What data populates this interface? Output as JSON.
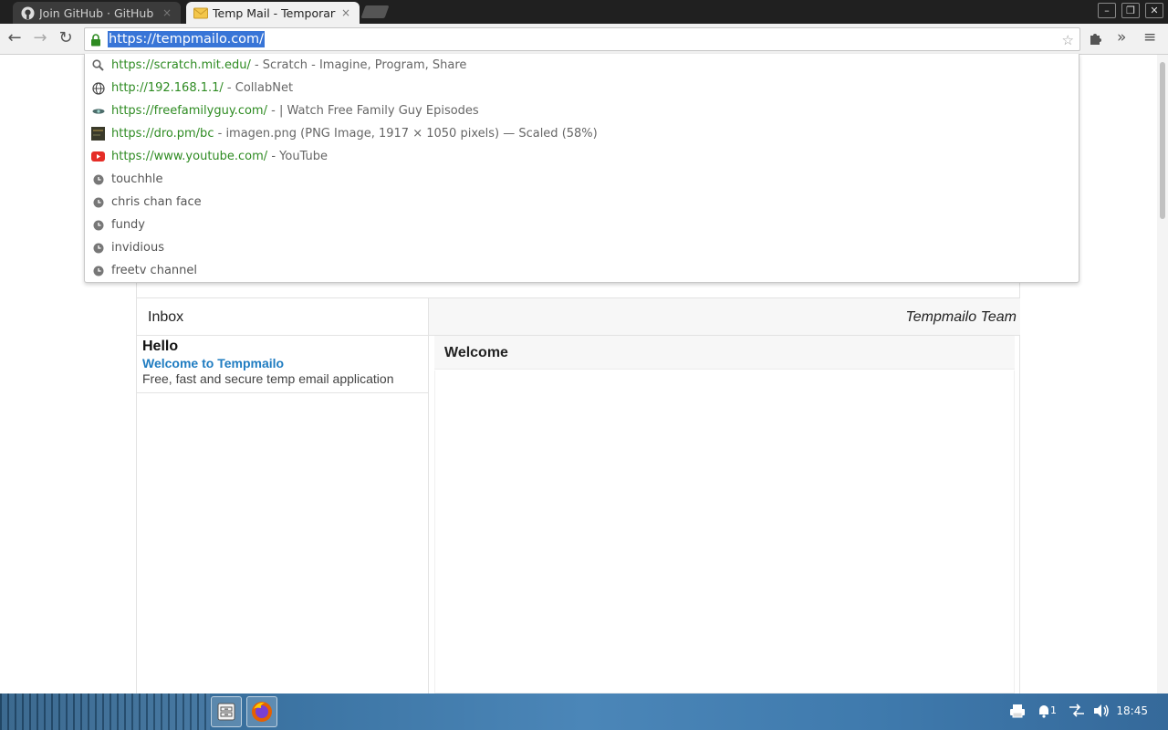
{
  "browser": {
    "tabs": [
      {
        "title": "Join GitHub · GitHub",
        "icon": "github-icon",
        "active": false
      },
      {
        "title": "Temp Mail - Temporary D",
        "icon": "envelope-icon",
        "active": true
      }
    ],
    "tab_close_glyph": "×",
    "window_controls": {
      "minimize": "–",
      "restore": "❐",
      "close": "✕"
    },
    "toolbar": {
      "back": "←",
      "forward": "→",
      "reload": "↻",
      "star": "☆",
      "extensions": "»",
      "menu": "≡"
    },
    "omnibox": {
      "url": "https://tempmailo.com/",
      "secure": true,
      "selected": true
    }
  },
  "suggestions": [
    {
      "icon": "search-icon",
      "url": "https://scratch.mit.edu/",
      "title": "Scratch - Imagine, Program, Share"
    },
    {
      "icon": "globe-icon",
      "url": "http://192.168.1.1/",
      "title": "CollabNet"
    },
    {
      "icon": "site-favicon-icon",
      "url": "https://freefamilyguy.com/",
      "title": "| Watch Free Family Guy Episodes"
    },
    {
      "icon": "image-favicon-icon",
      "url": "https://dro.pm/bc",
      "title": "imagen.png (PNG Image, 1917 × 1050 pixels) — Scaled (58%)"
    },
    {
      "icon": "youtube-icon",
      "url": "https://www.youtube.com/",
      "title": "YouTube"
    },
    {
      "icon": "history-icon",
      "query": "touchhle"
    },
    {
      "icon": "history-icon",
      "query": "chris chan face"
    },
    {
      "icon": "history-icon",
      "query": "fundy"
    },
    {
      "icon": "history-icon",
      "query": "invidious"
    },
    {
      "icon": "history-icon",
      "query": "freetv channel"
    }
  ],
  "mail": {
    "inbox_label": "Inbox",
    "team_label": "Tempmailo Team",
    "messages": [
      {
        "from": "Hello",
        "subject": "Welcome to Tempmailo",
        "preview": "Free, fast and secure temp email application"
      }
    ],
    "open_message_title": "Welcome"
  },
  "taskbar": {
    "clock": "18:45",
    "tray_icons": [
      "printer-icon",
      "notification-icon",
      "network-icon",
      "volume-icon"
    ],
    "notification_count": "1",
    "apps": [
      "file-manager-icon",
      "firefox-icon"
    ]
  },
  "colors": {
    "url_green": "#2e8b22",
    "link_blue": "#1f7cc1",
    "selection_blue": "#3875d7"
  }
}
